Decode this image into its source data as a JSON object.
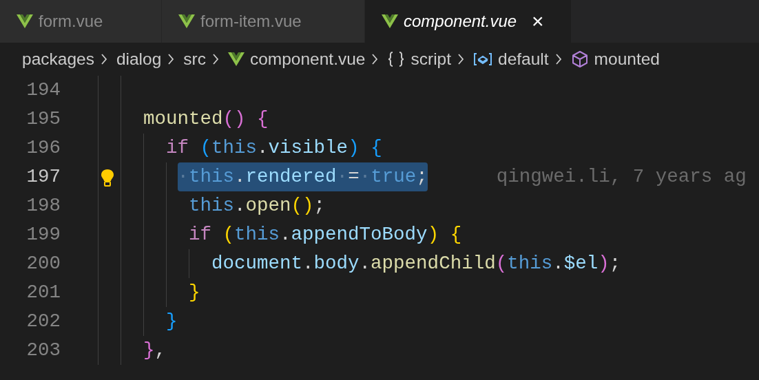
{
  "tabs": [
    {
      "label": "form.vue",
      "selected": false,
      "preview": false
    },
    {
      "label": "form-item.vue",
      "selected": false,
      "preview": false
    },
    {
      "label": "component.vue",
      "selected": true,
      "preview": true,
      "close": "×"
    }
  ],
  "breadcrumbs": [
    {
      "label": "packages",
      "kind": "folder"
    },
    {
      "label": "dialog",
      "kind": "folder"
    },
    {
      "label": "src",
      "kind": "folder"
    },
    {
      "label": "component.vue",
      "kind": "file"
    },
    {
      "label": "script",
      "kind": "namespace"
    },
    {
      "label": "default",
      "kind": "module"
    },
    {
      "label": "mounted",
      "kind": "method"
    }
  ],
  "editor": {
    "lines": [
      {
        "number": "194",
        "current": false,
        "selected": false,
        "lightbulb": false
      },
      {
        "number": "195",
        "current": false,
        "selected": false,
        "lightbulb": false,
        "tokens": [
          {
            "kind": "function",
            "text": "    mounted"
          },
          {
            "kind": "bracket2",
            "text": "()"
          },
          {
            "kind": "bracket2",
            "text": " {"
          }
        ]
      },
      {
        "number": "196",
        "current": false,
        "selected": false,
        "lightbulb": false,
        "tokens": [
          {
            "kind": "keyword",
            "text": "      if"
          },
          {
            "kind": "bracket3",
            "text": " ("
          },
          {
            "kind": "self",
            "text": "this"
          },
          {
            "kind": "punct",
            "text": "."
          },
          {
            "kind": "property",
            "text": "visible"
          },
          {
            "kind": "bracket3",
            "text": ")"
          },
          {
            "kind": "bracket3",
            "text": " {"
          }
        ]
      },
      {
        "number": "197",
        "current": true,
        "selected": true,
        "lightbulb": true,
        "blame": "qingwei.li, 7 years ag",
        "tokens": [
          {
            "kind": "space",
            "text": "       ·"
          },
          {
            "kind": "self",
            "text": "this"
          },
          {
            "kind": "punct",
            "text": "."
          },
          {
            "kind": "property",
            "text": "rendered"
          },
          {
            "kind": "space",
            "text": "·"
          },
          {
            "kind": "punct",
            "text": "="
          },
          {
            "kind": "space",
            "text": "·"
          },
          {
            "kind": "self",
            "text": "true"
          },
          {
            "kind": "punct",
            "text": ";"
          }
        ]
      },
      {
        "number": "198",
        "current": false,
        "selected": false,
        "lightbulb": false,
        "tokens": [
          {
            "kind": "self",
            "text": "        this"
          },
          {
            "kind": "punct",
            "text": "."
          },
          {
            "kind": "function",
            "text": "open"
          },
          {
            "kind": "bracket1",
            "text": "()"
          },
          {
            "kind": "punct",
            "text": ";"
          }
        ]
      },
      {
        "number": "199",
        "current": false,
        "selected": false,
        "lightbulb": false,
        "tokens": [
          {
            "kind": "keyword",
            "text": "        if"
          },
          {
            "kind": "bracket1",
            "text": " ("
          },
          {
            "kind": "self",
            "text": "this"
          },
          {
            "kind": "punct",
            "text": "."
          },
          {
            "kind": "property",
            "text": "appendToBody"
          },
          {
            "kind": "bracket1",
            "text": ")"
          },
          {
            "kind": "bracket1",
            "text": " {"
          }
        ]
      },
      {
        "number": "200",
        "current": false,
        "selected": false,
        "lightbulb": false,
        "tokens": [
          {
            "kind": "property",
            "text": "          document"
          },
          {
            "kind": "punct",
            "text": "."
          },
          {
            "kind": "property",
            "text": "body"
          },
          {
            "kind": "punct",
            "text": "."
          },
          {
            "kind": "function",
            "text": "appendChild"
          },
          {
            "kind": "bracket2",
            "text": "("
          },
          {
            "kind": "self",
            "text": "this"
          },
          {
            "kind": "punct",
            "text": "."
          },
          {
            "kind": "property",
            "text": "$el"
          },
          {
            "kind": "bracket2",
            "text": ")"
          },
          {
            "kind": "punct",
            "text": ";"
          }
        ]
      },
      {
        "number": "201",
        "current": false,
        "selected": false,
        "lightbulb": false,
        "tokens": [
          {
            "kind": "bracket1",
            "text": "        }"
          }
        ]
      },
      {
        "number": "202",
        "current": false,
        "selected": false,
        "lightbulb": false,
        "tokens": [
          {
            "kind": "bracket3",
            "text": "      }"
          }
        ]
      },
      {
        "number": "203",
        "current": false,
        "selected": false,
        "lightbulb": false,
        "tokens": [
          {
            "kind": "bracket2",
            "text": "    }"
          },
          {
            "kind": "punct",
            "text": ","
          }
        ]
      }
    ]
  }
}
